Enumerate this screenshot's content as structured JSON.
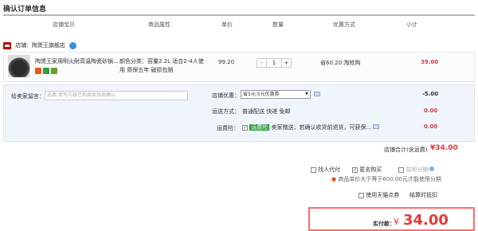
{
  "page_title": "确认订单信息",
  "columns": [
    "店铺宝贝",
    "商品属性",
    "单价",
    "数量",
    "优惠方式",
    "小计"
  ],
  "store": {
    "label": "店铺:",
    "name": "陶煲王旗舰店"
  },
  "item": {
    "title": "陶煲王家用明火耐高温陶瓷砂锅...",
    "attrs": "颜色分类：容量2.2L 适合2-4人使",
    "attrs2": "用  质保五年  破损包赔",
    "price": "99.20",
    "qty": "1",
    "qty_minus": "-",
    "qty_plus": "+",
    "discount": "省60.20:淘抢购",
    "subtotal": "39.00"
  },
  "message": {
    "label": "给卖家留言：",
    "placeholder": "选填:填写内容已和卖家协商确认"
  },
  "coupon": {
    "label": "店铺优惠：",
    "selected": "省5元:5元优惠券",
    "value": "-5.00"
  },
  "shipping": {
    "label": "运送方式：",
    "text": "普通配送 快递 免邮",
    "value": "0.00"
  },
  "insurance": {
    "label": "运费险：",
    "tag": "运费险",
    "text": "卖家赠送，若确认收货前退货，可获保...",
    "value": "0.00"
  },
  "store_total": {
    "label": "店铺合计(含运费)",
    "value": "¥34.00"
  },
  "options": {
    "proxy": "找人代付",
    "anonymous": "匿名购买",
    "installment": "花呗分期",
    "installment_note": "商品单价大于等于600.00元才能使用分期"
  },
  "card": {
    "label": "使用天猫点券",
    "action": "结算时抵扣"
  },
  "pay": {
    "label": "实付款：",
    "currency": "¥",
    "amount": "34.00"
  },
  "colors": {
    "accent": "#e4393c",
    "panel": "#f0f4fb",
    "border": "#ff6d6d"
  }
}
